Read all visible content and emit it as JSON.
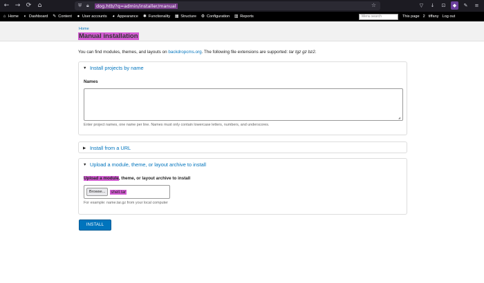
{
  "browser": {
    "nav": [
      "←",
      "→",
      "⟳",
      "⌂"
    ],
    "url": "dog.htb/?q=admin/installer/manual",
    "right_icons": [
      "▽",
      "↓",
      "⊡",
      "◆",
      "✎",
      "≡"
    ]
  },
  "admin_bar": {
    "items": [
      {
        "icon": "⌂",
        "label": "Home"
      },
      {
        "icon": "◐",
        "label": "Dashboard"
      },
      {
        "icon": "✎",
        "label": "Content"
      },
      {
        "icon": "●",
        "label": "User accounts"
      },
      {
        "icon": "◕",
        "label": "Appearance"
      },
      {
        "icon": "✱",
        "label": "Functionality"
      },
      {
        "icon": "▦",
        "label": "Structure"
      },
      {
        "icon": "⚙",
        "label": "Configuration"
      },
      {
        "icon": "▥",
        "label": "Reports"
      }
    ],
    "search_placeholder": "Menu search",
    "this_page": "This page",
    "count": "2",
    "user": "tiffany",
    "logout": "Log out"
  },
  "header": {
    "breadcrumb": "Home",
    "title": "Manual installation"
  },
  "intro": {
    "before_link": "You can find modules, themes, and layouts on ",
    "link": "backdropcms.org",
    "after_link": ". The following file extensions are supported: ",
    "extensions": "tar tgz gz bz2",
    "end": "."
  },
  "install_by_name": {
    "legend": "Install projects by name",
    "label": "Names",
    "help": "Enter project names, one name per line. Names must only contain lowercase letters, numbers, and underscores."
  },
  "install_from_url": {
    "legend": "Install from a URL"
  },
  "upload": {
    "legend": "Upload a module, theme, or layout archive to install",
    "label_highlight": "Upload a module",
    "label_rest": ", theme, or layout archive to install",
    "browse": "Browse...",
    "filename": "shell.tar",
    "help": "For example: name.tar.gz from your local computer"
  },
  "install_button": "INSTALL",
  "colors": {
    "link": "#0074bd",
    "highlight": "#d35bd3",
    "admin_bar": "#000000"
  }
}
